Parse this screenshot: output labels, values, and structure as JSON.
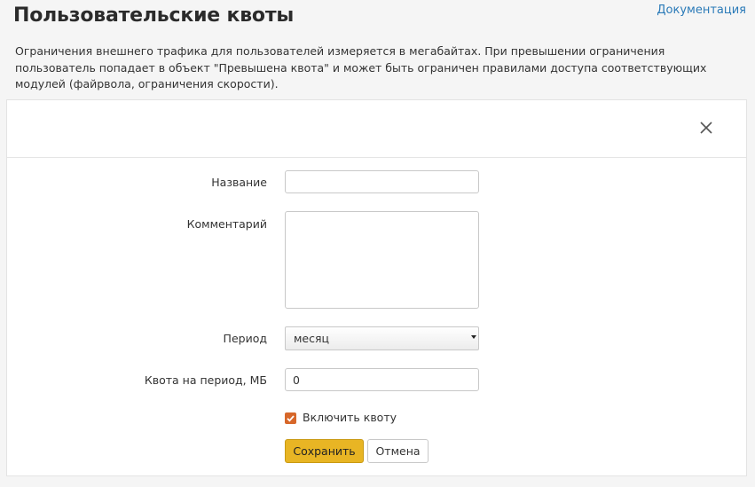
{
  "page": {
    "title": "Пользовательские квоты",
    "docs_link": "Документация",
    "description": "Ограничения внешнего трафика для пользователей измеряется в мегабайтах. При превышении ограничения пользователь попадает в объект \"Превышена квота\" и может быть ограничен правилами доступа соответствующих модулей (файрвола, ограничения скорости)."
  },
  "form": {
    "name_label": "Название",
    "name_value": "",
    "comment_label": "Комментарий",
    "comment_value": "",
    "period_label": "Период",
    "period_selected": "месяц",
    "quota_label": "Квота на период, МБ",
    "quota_value": "0",
    "enable_label": "Включить квоту",
    "enable_checked": true,
    "save_label": "Сохранить",
    "cancel_label": "Отмена"
  },
  "icons": {
    "close": "close-icon",
    "checkmark": "checkmark-icon",
    "dropdown": "chevron-down-icon"
  },
  "colors": {
    "link": "#2a7ab8",
    "primary_button": "#e8b524",
    "checkbox": "#d7672a"
  }
}
